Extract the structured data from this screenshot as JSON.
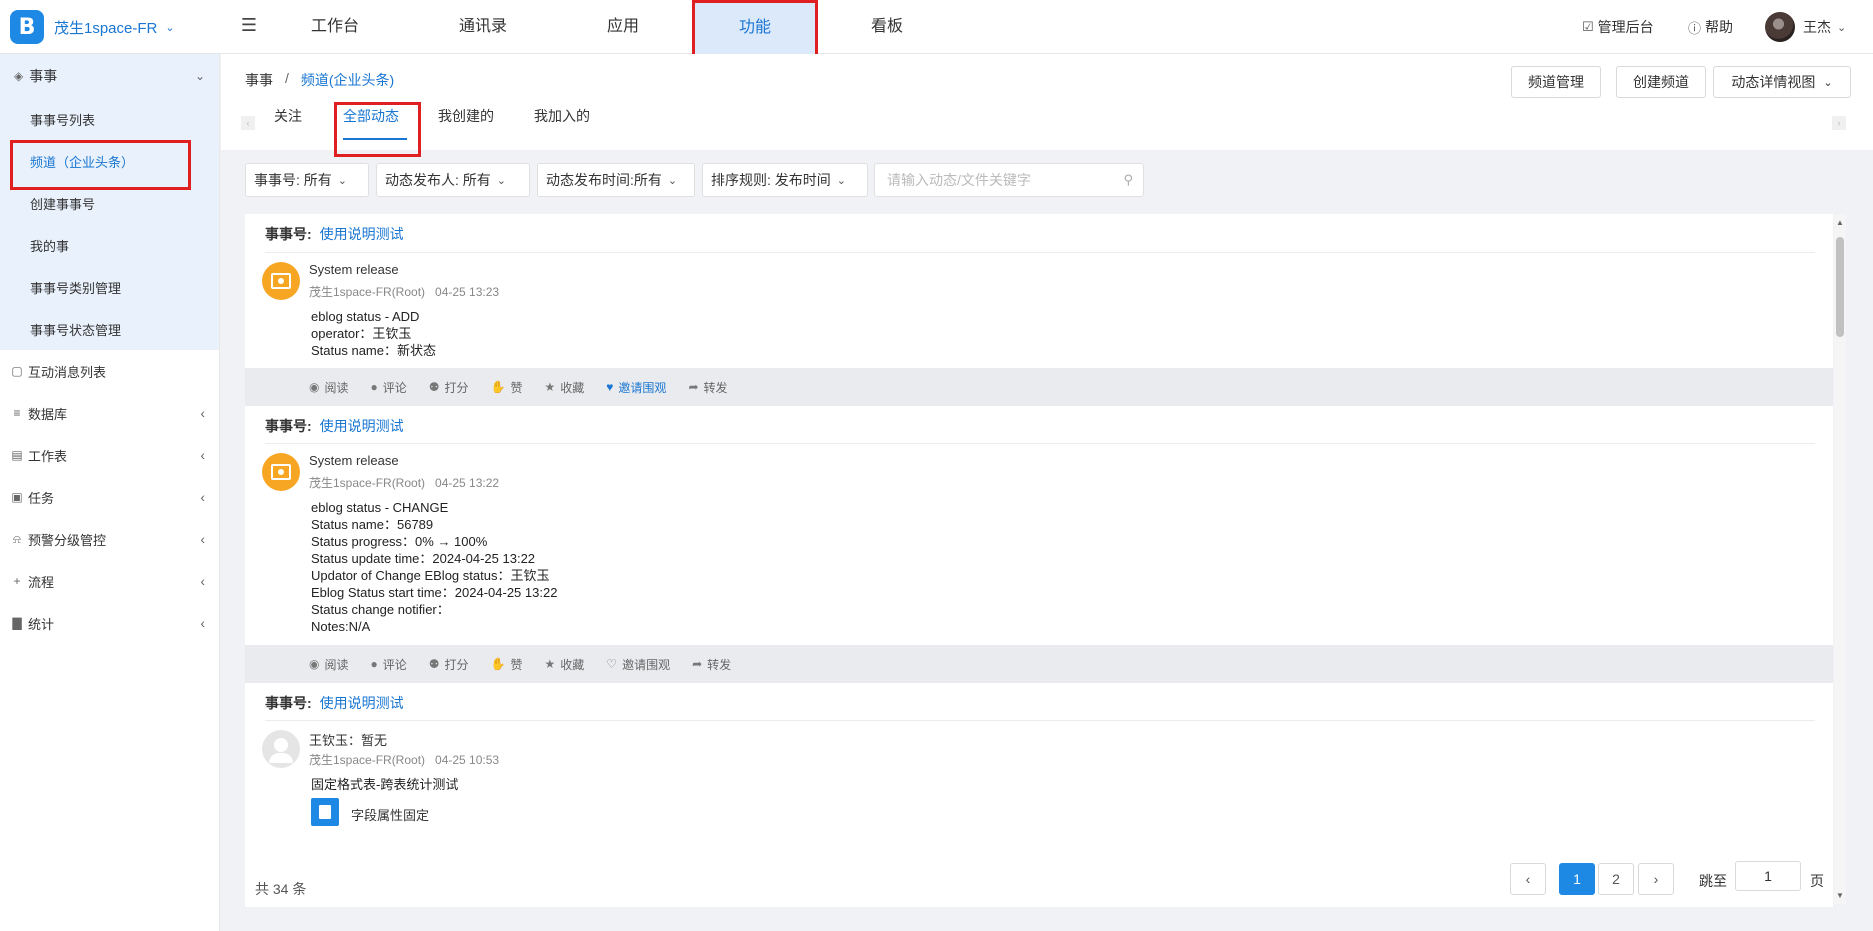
{
  "brand": {
    "name": "茂生1space-FR",
    "logo_letter": "B"
  },
  "top_nav": {
    "items": [
      {
        "label": "工作台"
      },
      {
        "label": "通讯录"
      },
      {
        "label": "应用"
      },
      {
        "label": "功能",
        "active": true
      },
      {
        "label": "看板"
      }
    ]
  },
  "top_right": {
    "admin": "管理后台",
    "help": "帮助",
    "user": "王杰"
  },
  "sidebar": {
    "group": {
      "label": "事事",
      "icon": "layers-icon"
    },
    "sub_items": [
      {
        "label": "事事号列表"
      },
      {
        "label": "频道（企业头条）",
        "active": true
      },
      {
        "label": "创建事事号"
      },
      {
        "label": "我的事"
      },
      {
        "label": "事事号类别管理"
      },
      {
        "label": "事事号状态管理"
      }
    ],
    "items": [
      {
        "label": "互动消息列表",
        "icon": "message-icon",
        "has_caret": false
      },
      {
        "label": "数据库",
        "icon": "database-icon",
        "has_caret": true
      },
      {
        "label": "工作表",
        "icon": "worksheet-icon",
        "has_caret": true
      },
      {
        "label": "任务",
        "icon": "task-icon",
        "has_caret": true
      },
      {
        "label": "预警分级管控",
        "icon": "bell-icon",
        "has_caret": true
      },
      {
        "label": "流程",
        "icon": "plus-icon",
        "has_caret": true
      },
      {
        "label": "统计",
        "icon": "chart-icon",
        "has_caret": true
      }
    ]
  },
  "breadcrumb": {
    "root": "事事",
    "sep": "/",
    "current": "频道(企业头条)"
  },
  "header_buttons": {
    "manage": "频道管理",
    "create": "创建频道",
    "view": "动态详情视图"
  },
  "tabs": [
    {
      "label": "关注"
    },
    {
      "label": "全部动态",
      "active": true
    },
    {
      "label": "我创建的"
    },
    {
      "label": "我加入的"
    }
  ],
  "filters": [
    {
      "label": "事事号:",
      "value": "所有"
    },
    {
      "label": "动态发布人:",
      "value": "所有"
    },
    {
      "label": "动态发布时间:",
      "value": "所有"
    },
    {
      "label": "排序规则:",
      "value": "发布时间"
    }
  ],
  "search": {
    "placeholder": "请输入动态/文件关键字"
  },
  "action_labels": {
    "read": "阅读",
    "comment": "评论",
    "rate": "打分",
    "like": "赞",
    "fav": "收藏",
    "invite": "邀请围观",
    "forward": "转发"
  },
  "posts": [
    {
      "channel_label": "事事号:",
      "channel": "使用说明测试",
      "author": "System release",
      "org": "茂生1space-FR(Root)",
      "time": "04-25 13:23",
      "lines": [
        "eblog status - ADD",
        "operator：王钦玉",
        "Status name：新状态"
      ],
      "invite_active": true
    },
    {
      "channel_label": "事事号:",
      "channel": "使用说明测试",
      "author": "System release",
      "org": "茂生1space-FR(Root)",
      "time": "04-25 13:22",
      "lines": [
        "eblog status - CHANGE",
        "Status name：56789",
        "Status progress：0% → 100%",
        "Status update time：2024-04-25 13:22",
        "Updator of Change EBlog status：王钦玉",
        "Eblog Status start time：2024-04-25 13:22",
        "Status change notifier：",
        "Notes:N/A"
      ],
      "invite_active": false
    },
    {
      "channel_label": "事事号:",
      "channel": "使用说明测试",
      "author": "王钦玉：暂无",
      "org": "茂生1space-FR(Root)",
      "time": "04-25 10:53",
      "lines": [
        "固定格式表-跨表统计测试"
      ],
      "file": "字段属性固定"
    }
  ],
  "pagination": {
    "total": "共 34 条",
    "pages": [
      "1",
      "2"
    ],
    "current": "1",
    "jump_label": "跳至",
    "jump_value": "1",
    "page_suffix": "页"
  }
}
